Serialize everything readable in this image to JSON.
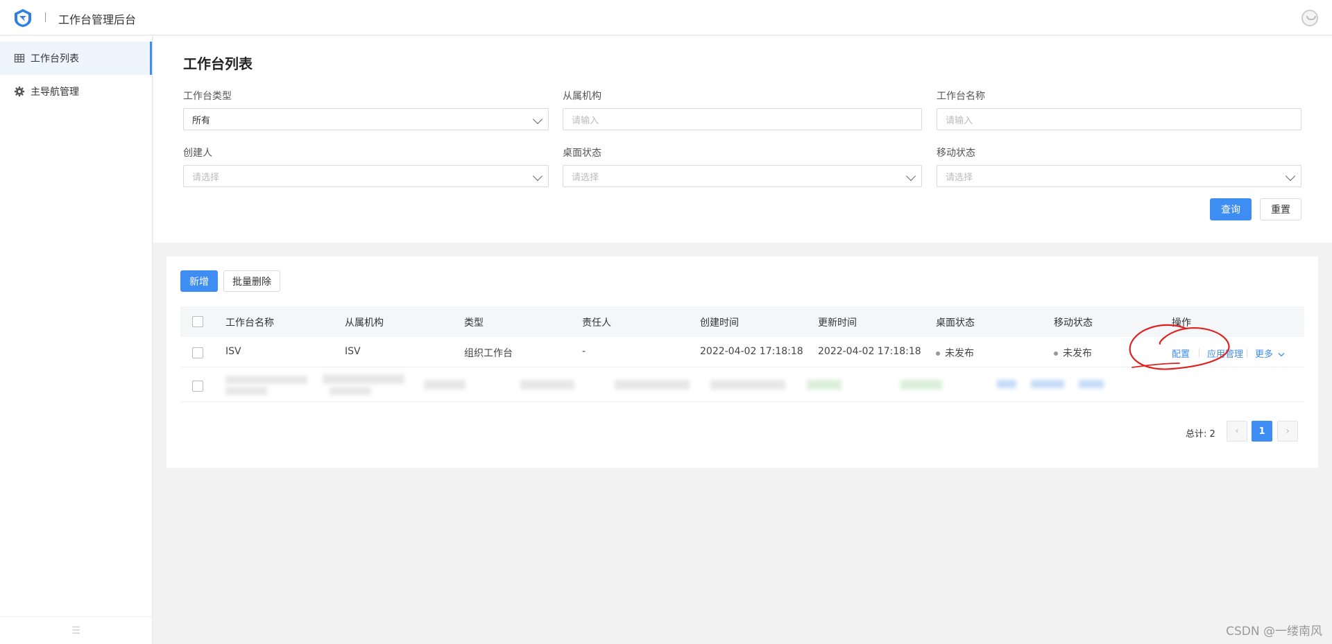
{
  "header": {
    "title": "工作台管理后台",
    "logo_icon": "shield-bird-logo",
    "avatar_icon": "user-avatar-icon"
  },
  "sidebar": {
    "items": [
      {
        "label": "工作台列表",
        "icon": "table-icon",
        "active": true
      },
      {
        "label": "主导航管理",
        "icon": "gear-icon",
        "active": false
      }
    ],
    "collapse_icon": "menu-collapse-icon"
  },
  "filters": {
    "title": "工作台列表",
    "type": {
      "label": "工作台类型",
      "value": "所有"
    },
    "org": {
      "label": "从属机构",
      "placeholder": "请输入"
    },
    "name": {
      "label": "工作台名称",
      "placeholder": "请输入"
    },
    "creator": {
      "label": "创建人",
      "placeholder": "请选择"
    },
    "desktop_status": {
      "label": "桌面状态",
      "placeholder": "请选择"
    },
    "mobile_status": {
      "label": "移动状态",
      "placeholder": "请选择"
    },
    "query_label": "查询",
    "reset_label": "重置"
  },
  "toolbar": {
    "add_label": "新增",
    "batch_delete_label": "批量删除"
  },
  "table": {
    "columns": [
      "工作台名称",
      "从属机构",
      "类型",
      "责任人",
      "创建时间",
      "更新时间",
      "桌面状态",
      "移动状态",
      "操作"
    ],
    "rows": [
      {
        "name": "ISV",
        "org": "ISV",
        "type": "组织工作台",
        "owner": "-",
        "created": "2022-04-02 17:18:18",
        "updated": "2022-04-02 17:18:18",
        "desktop_status": "未发布",
        "mobile_status": "未发布",
        "actions": {
          "config": "配置",
          "app_manage": "应用管理",
          "more": "更多"
        }
      }
    ],
    "blurred_row_count": 1
  },
  "pagination": {
    "total_text": "总计: 2",
    "current_page": "1",
    "prev_icon": "chevron-left-icon",
    "next_icon": "chevron-right-icon"
  },
  "accent_color": "#3d8df2",
  "annotation_color": "#e02020",
  "watermark": "CSDN @一缕南风"
}
